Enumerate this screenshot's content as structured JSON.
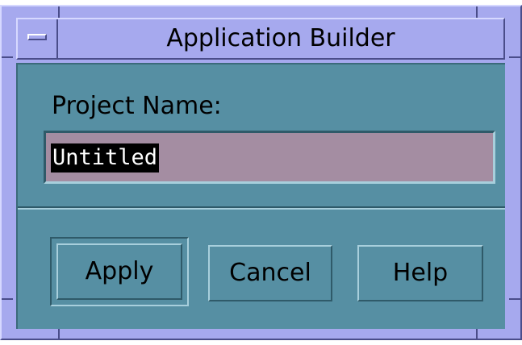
{
  "window": {
    "title": "Application Builder",
    "menu_icon": "window-menu-icon"
  },
  "form": {
    "project_label": "Project Name:",
    "project_value": "Untitled",
    "project_value_selected": true
  },
  "buttons": {
    "apply_label": "Apply",
    "cancel_label": "Cancel",
    "help_label": "Help",
    "default": "apply"
  },
  "colors": {
    "frame": "#a6a9ee",
    "client": "#568fa3",
    "input_bg": "#a48da2",
    "selection_bg": "#000000"
  }
}
